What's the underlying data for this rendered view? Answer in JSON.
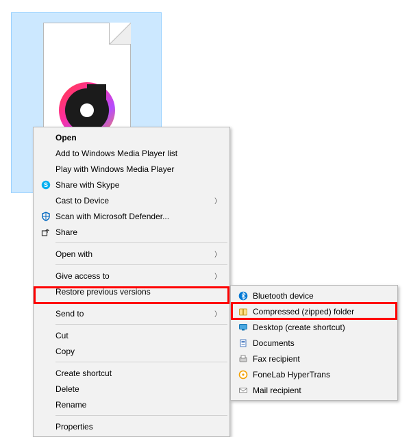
{
  "file_icon": {
    "name": "groove-music-file-icon"
  },
  "primary_menu": {
    "open": "Open",
    "add_wmp_list": "Add to Windows Media Player list",
    "play_wmp": "Play with Windows Media Player",
    "share_skype": "Share with Skype",
    "cast": "Cast to Device",
    "scan_defender": "Scan with Microsoft Defender...",
    "share": "Share",
    "open_with": "Open with",
    "give_access": "Give access to",
    "restore_versions": "Restore previous versions",
    "send_to": "Send to",
    "cut": "Cut",
    "copy": "Copy",
    "create_shortcut": "Create shortcut",
    "delete": "Delete",
    "rename": "Rename",
    "properties": "Properties"
  },
  "sub_menu": {
    "bluetooth": "Bluetooth device",
    "compressed": "Compressed (zipped) folder",
    "desktop_shortcut": "Desktop (create shortcut)",
    "documents": "Documents",
    "fax": "Fax recipient",
    "fonelab": "FoneLab HyperTrans",
    "mail": "Mail recipient"
  },
  "highlights": {
    "primary": "send-to",
    "sub": "compressed-zipped-folder"
  }
}
